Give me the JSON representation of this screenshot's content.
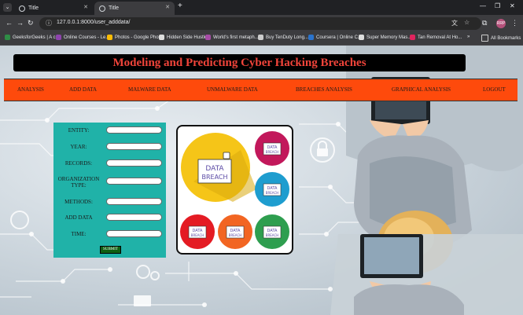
{
  "browser": {
    "tabs": [
      {
        "title": "Title"
      },
      {
        "title": "Title"
      }
    ],
    "url": "127.0.0.1:8000/user_adddata/",
    "avatar_text": "RRP",
    "bookmarks": [
      {
        "label": "GeeksforGeeks | A c...",
        "color": "#2f8d46"
      },
      {
        "label": "Online Courses - Le...",
        "color": "#8e44ad"
      },
      {
        "label": "Photos - Google Pho...",
        "color": "#fbbc05"
      },
      {
        "label": "Hidden Side Hustle",
        "color": "#dddddd"
      },
      {
        "label": "World's first metaph...",
        "color": "#a64ca6"
      },
      {
        "label": "Buy TenDuty Long...",
        "color": "#cccccc"
      },
      {
        "label": "Coursera | Online C...",
        "color": "#2a73cc"
      },
      {
        "label": "Super Memory Mas...",
        "color": "#dddddd"
      },
      {
        "label": "Tan Removal At Ho...",
        "color": "#e0245e"
      }
    ],
    "all_bookmarks": "All Bookmarks"
  },
  "page": {
    "title": "Modeling and Predicting Cyber Hacking Breaches",
    "nav": [
      {
        "label": "ANALYSIS"
      },
      {
        "label": "ADD DATA"
      },
      {
        "label": "MALWARE DATA"
      },
      {
        "label": "UNMALWARE DATA"
      },
      {
        "label": "BREACHES ANALYSIS"
      },
      {
        "label": "GRAPHICAL ANALYSIS"
      },
      {
        "label": "LOGOUT"
      }
    ],
    "form": {
      "fields": [
        {
          "label": "ENTITY:",
          "value": ""
        },
        {
          "label": "YEAR:",
          "value": ""
        },
        {
          "label": "RECORDS:",
          "value": ""
        },
        {
          "label": "ORGANIZATION TYPE:",
          "value": ""
        },
        {
          "label": "METHODS:",
          "value": ""
        },
        {
          "label": "ADD DATA",
          "value": ""
        },
        {
          "label": "TIME:",
          "value": ""
        }
      ],
      "submit": "SUBMIT"
    },
    "badges": {
      "big": [
        "DATA",
        "BREACH"
      ],
      "small": [
        "DATA",
        "BREACH"
      ]
    },
    "colors": {
      "menu": "#fe4a0c",
      "form_panel": "#20b2a8",
      "title_text": "#f0443a",
      "badge_yellow": "#f5c518",
      "badge_magenta": "#c2185b",
      "badge_cyan": "#1e9dcf",
      "badge_red": "#e41b23",
      "badge_orange": "#f26522",
      "badge_green": "#2e9e4f"
    }
  }
}
